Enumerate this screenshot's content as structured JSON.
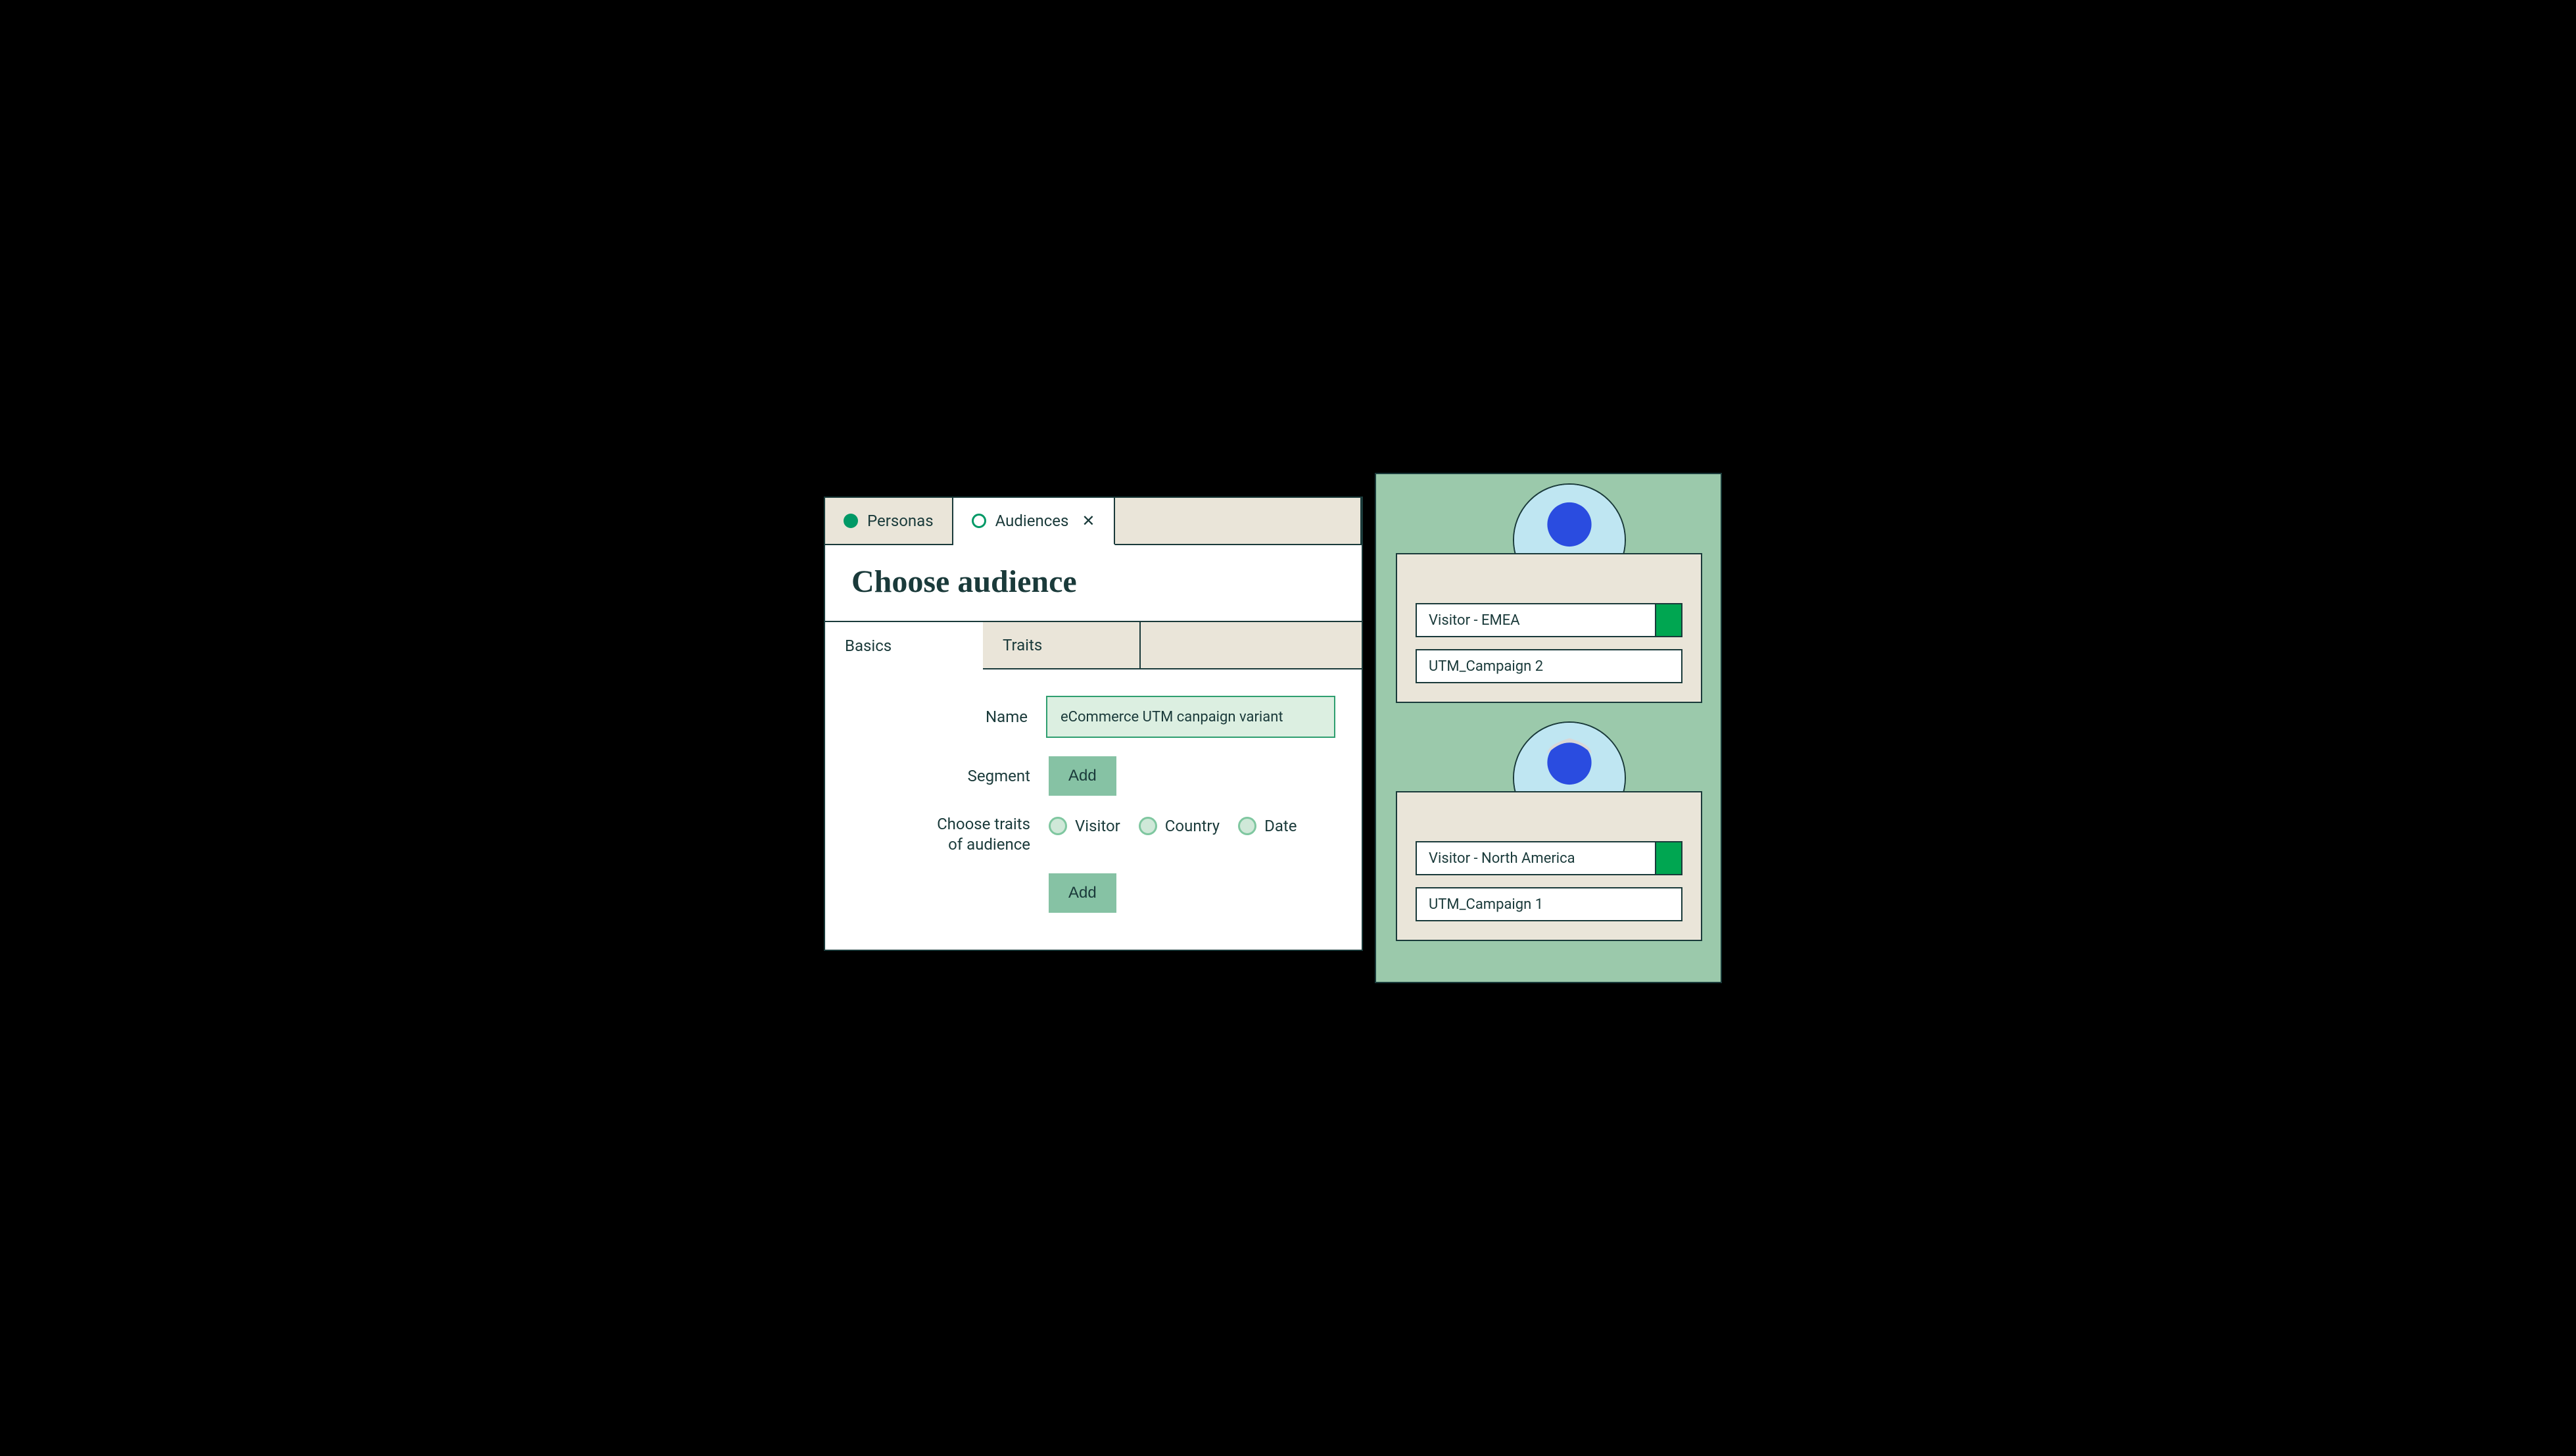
{
  "tabs": {
    "personas": "Personas",
    "audiences": "Audiences"
  },
  "page_title": "Choose audience",
  "subtabs": {
    "basics": "Basics",
    "traits": "Traits"
  },
  "form": {
    "name_label": "Name",
    "name_value": "eCommerce UTM canpaign variant",
    "segment_label": "Segment",
    "segment_add": "Add",
    "traits_label_line1": "Choose traits",
    "traits_label_line2": "of audience",
    "trait_visitor": "Visitor",
    "trait_country": "Country",
    "trait_date": "Date",
    "traits_add": "Add"
  },
  "cards": [
    {
      "visitor": "Visitor - EMEA",
      "campaign": "UTM_Campaign 2"
    },
    {
      "visitor": "Visitor - North America",
      "campaign": "UTM_Campaign 1"
    }
  ]
}
